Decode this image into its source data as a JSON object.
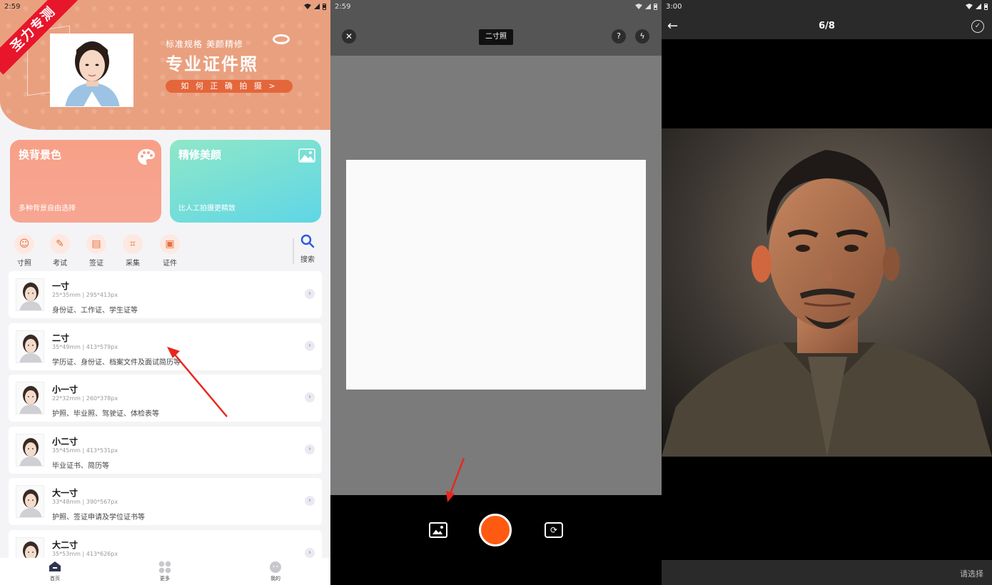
{
  "panel1": {
    "status_time": "2:59",
    "watermark": "圣力专测",
    "banner": {
      "subtitle": "标准规格 美颜精修",
      "title": "专业证件照",
      "button": "如 何 正 确 拍 摄 >"
    },
    "cards": [
      {
        "title": "换背景色",
        "desc": "多种背景自由选择",
        "icon": "palette-icon"
      },
      {
        "title": "精修美颜",
        "desc": "比人工拍摄更精致",
        "icon": "image-icon"
      }
    ],
    "categories": [
      {
        "label": "寸照",
        "icon": "portrait-icon"
      },
      {
        "label": "考试",
        "icon": "pen-icon"
      },
      {
        "label": "签证",
        "icon": "card-icon"
      },
      {
        "label": "采集",
        "icon": "scan-icon"
      },
      {
        "label": "证件",
        "icon": "id-icon"
      }
    ],
    "search_label": "搜索",
    "items": [
      {
        "title": "一寸",
        "size": "25*35mm | 295*413px",
        "desc": "身份证、工作证、学生证等"
      },
      {
        "title": "二寸",
        "size": "35*49mm | 413*579px",
        "desc": "学历证、身份证、档案文件及面试简历等"
      },
      {
        "title": "小一寸",
        "size": "22*32mm | 260*378px",
        "desc": "护照、毕业照、驾驶证、体检表等"
      },
      {
        "title": "小二寸",
        "size": "35*45mm | 413*531px",
        "desc": "毕业证书、简历等"
      },
      {
        "title": "大一寸",
        "size": "33*48mm | 390*567px",
        "desc": "护照、签证申请及学位证书等"
      },
      {
        "title": "大二寸",
        "size": "35*53mm | 413*626px",
        "desc": ""
      }
    ],
    "tabs": [
      {
        "label": "首页",
        "icon": "home-icon"
      },
      {
        "label": "更多",
        "icon": "grid-icon"
      },
      {
        "label": "我的",
        "icon": "profile-icon"
      }
    ],
    "accent": "#e9a07f"
  },
  "panel2": {
    "status_time": "2:59",
    "title": "二寸照",
    "help": "?",
    "shutter_color": "#ff5a12"
  },
  "panel3": {
    "status_time": "3:00",
    "counter": "6/8",
    "select_label": "请选择"
  }
}
